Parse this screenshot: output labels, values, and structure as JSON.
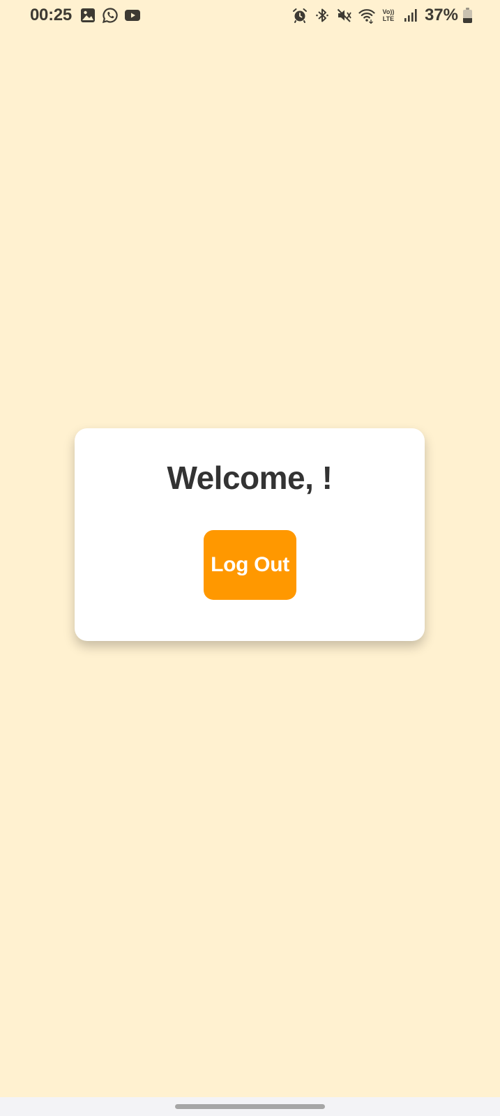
{
  "status_bar": {
    "time": "00:25",
    "notification_icons": [
      "gallery-icon",
      "whatsapp-icon",
      "youtube-icon"
    ],
    "system_icons": [
      "alarm-icon",
      "bluetooth-icon",
      "mute-icon",
      "wifi-icon",
      "volte-icon",
      "signal-icon"
    ],
    "volte_top": "Vo))",
    "volte_bottom": "LTE",
    "battery_percent_label": "37%",
    "battery_level": 0.37
  },
  "main": {
    "welcome_text": "Welcome, !",
    "logout_label": "Log Out"
  },
  "colors": {
    "background": "#FFF1D0",
    "card": "#FFFFFF",
    "accent": "#FF9800",
    "text": "#333333"
  }
}
